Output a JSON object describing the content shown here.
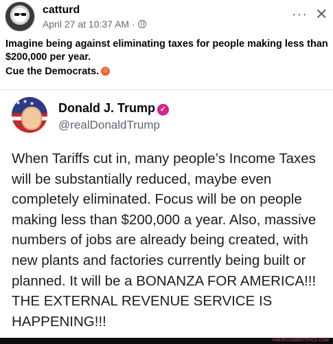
{
  "post": {
    "author": "catturd",
    "timestamp": "April 27 at 10:37 AM ·",
    "visibility_icon": "globe-icon",
    "more_label": "···",
    "close_label": "✕",
    "text_line1": "Imagine being against eliminating taxes for people making less than $200,000 per year.",
    "text_line2": "Cue the Democrats.",
    "emoji": "angry-face-emoji"
  },
  "tweet": {
    "name": "Donald J. Trump",
    "verified_badge": "✓",
    "handle": "@realDonaldTrump",
    "body": "When Tariffs cut in, many people’s Income Taxes will be substantially reduced, maybe even completely eliminated. Focus will be on people making less than $200,000 a year. Also, massive numbers of jobs are already being created, with new plants and factories currently being built or planned. It will be a BONANZA FOR AMERICA!!! THE EXTERNAL REVENUE SERVICE IS HAPPENING!!!"
  },
  "watermark": {
    "text": "AMERICASBESTPICS.COM"
  },
  "colors": {
    "secondary_text": "#65676b",
    "badge": "#d6248a",
    "watermark_text": "#e24a6b"
  }
}
